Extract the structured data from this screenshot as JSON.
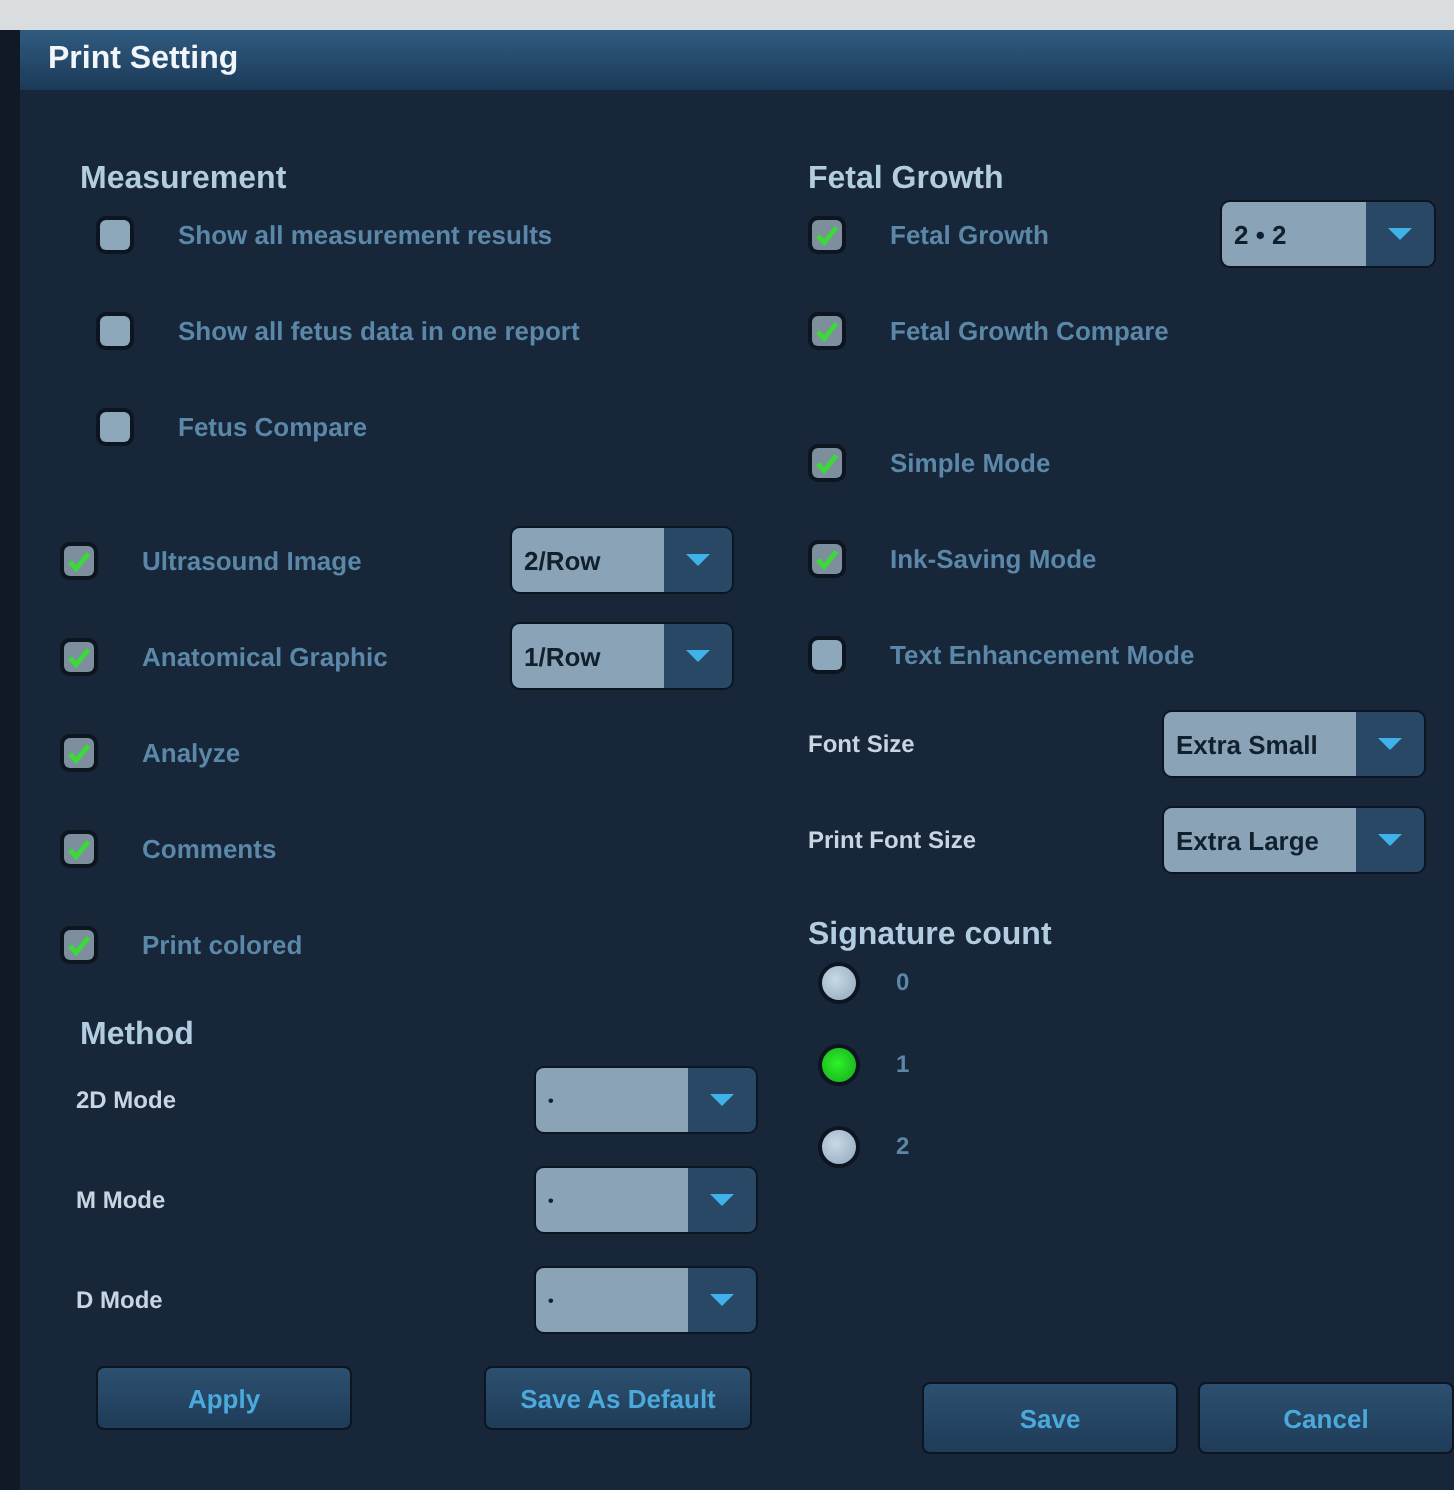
{
  "window": {
    "title": "Print Setting"
  },
  "measurement": {
    "heading": "Measurement",
    "options": [
      {
        "label": "Show all measurement results",
        "checked": false
      },
      {
        "label": "Show all fetus data in one report",
        "checked": false
      },
      {
        "label": "Fetus Compare",
        "checked": false
      }
    ]
  },
  "print_items": [
    {
      "label": "Ultrasound Image",
      "checked": true,
      "dropdown": "2/Row"
    },
    {
      "label": "Anatomical Graphic",
      "checked": true,
      "dropdown": "1/Row"
    },
    {
      "label": "Analyze",
      "checked": true
    },
    {
      "label": "Comments",
      "checked": true
    },
    {
      "label": "Print colored",
      "checked": true
    }
  ],
  "method": {
    "heading": "Method",
    "modes": [
      {
        "label": "2D Mode",
        "value": "•"
      },
      {
        "label": "M Mode",
        "value": "•"
      },
      {
        "label": "D Mode",
        "value": "•"
      }
    ]
  },
  "method_buttons": [
    "Apply",
    "Save As Default"
  ],
  "fetal_growth": {
    "heading": "Fetal Growth",
    "options": [
      {
        "label": "Fetal Growth",
        "checked": true,
        "dropdown": "2 • 2"
      },
      {
        "label": "Fetal Growth Compare",
        "checked": true
      }
    ]
  },
  "print_modes": [
    {
      "label": "Simple Mode",
      "checked": true
    },
    {
      "label": "Ink-Saving Mode",
      "checked": true
    },
    {
      "label": "Text Enhancement Mode",
      "checked": false
    }
  ],
  "font_settings": [
    {
      "label": "Font Size",
      "value": "Extra Small"
    },
    {
      "label": "Print Font Size",
      "value": "Extra Large"
    }
  ],
  "signature_count": {
    "heading": "Signature count",
    "options": [
      {
        "label": "0",
        "selected": false
      },
      {
        "label": "1",
        "selected": true
      },
      {
        "label": "2",
        "selected": false
      }
    ]
  },
  "buttons": [
    "Save",
    "Cancel"
  ]
}
